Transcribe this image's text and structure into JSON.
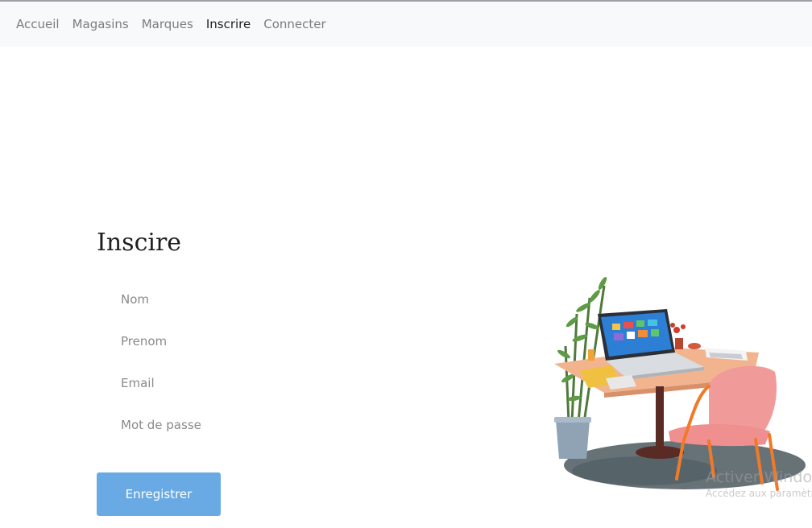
{
  "navbar": {
    "links": [
      {
        "label": "Accueil",
        "active": false
      },
      {
        "label": "Magasins",
        "active": false
      },
      {
        "label": "Marques",
        "active": false
      },
      {
        "label": "Inscrire",
        "active": true
      },
      {
        "label": "Connecter",
        "active": false
      }
    ]
  },
  "form": {
    "title": "Inscire",
    "fields": {
      "nom_placeholder": "Nom",
      "prenom_placeholder": "Prenom",
      "email_placeholder": "Email",
      "password_placeholder": "Mot de passe"
    },
    "submit_label": "Enregistrer"
  },
  "watermark": {
    "title": "Activer Windows",
    "subtitle": "Accédez aux paramètres"
  },
  "colors": {
    "navbar_bg": "#f8f9fa",
    "button_bg": "#6aaae4",
    "nav_link": "#7d7d7d",
    "nav_link_active": "#222222"
  }
}
